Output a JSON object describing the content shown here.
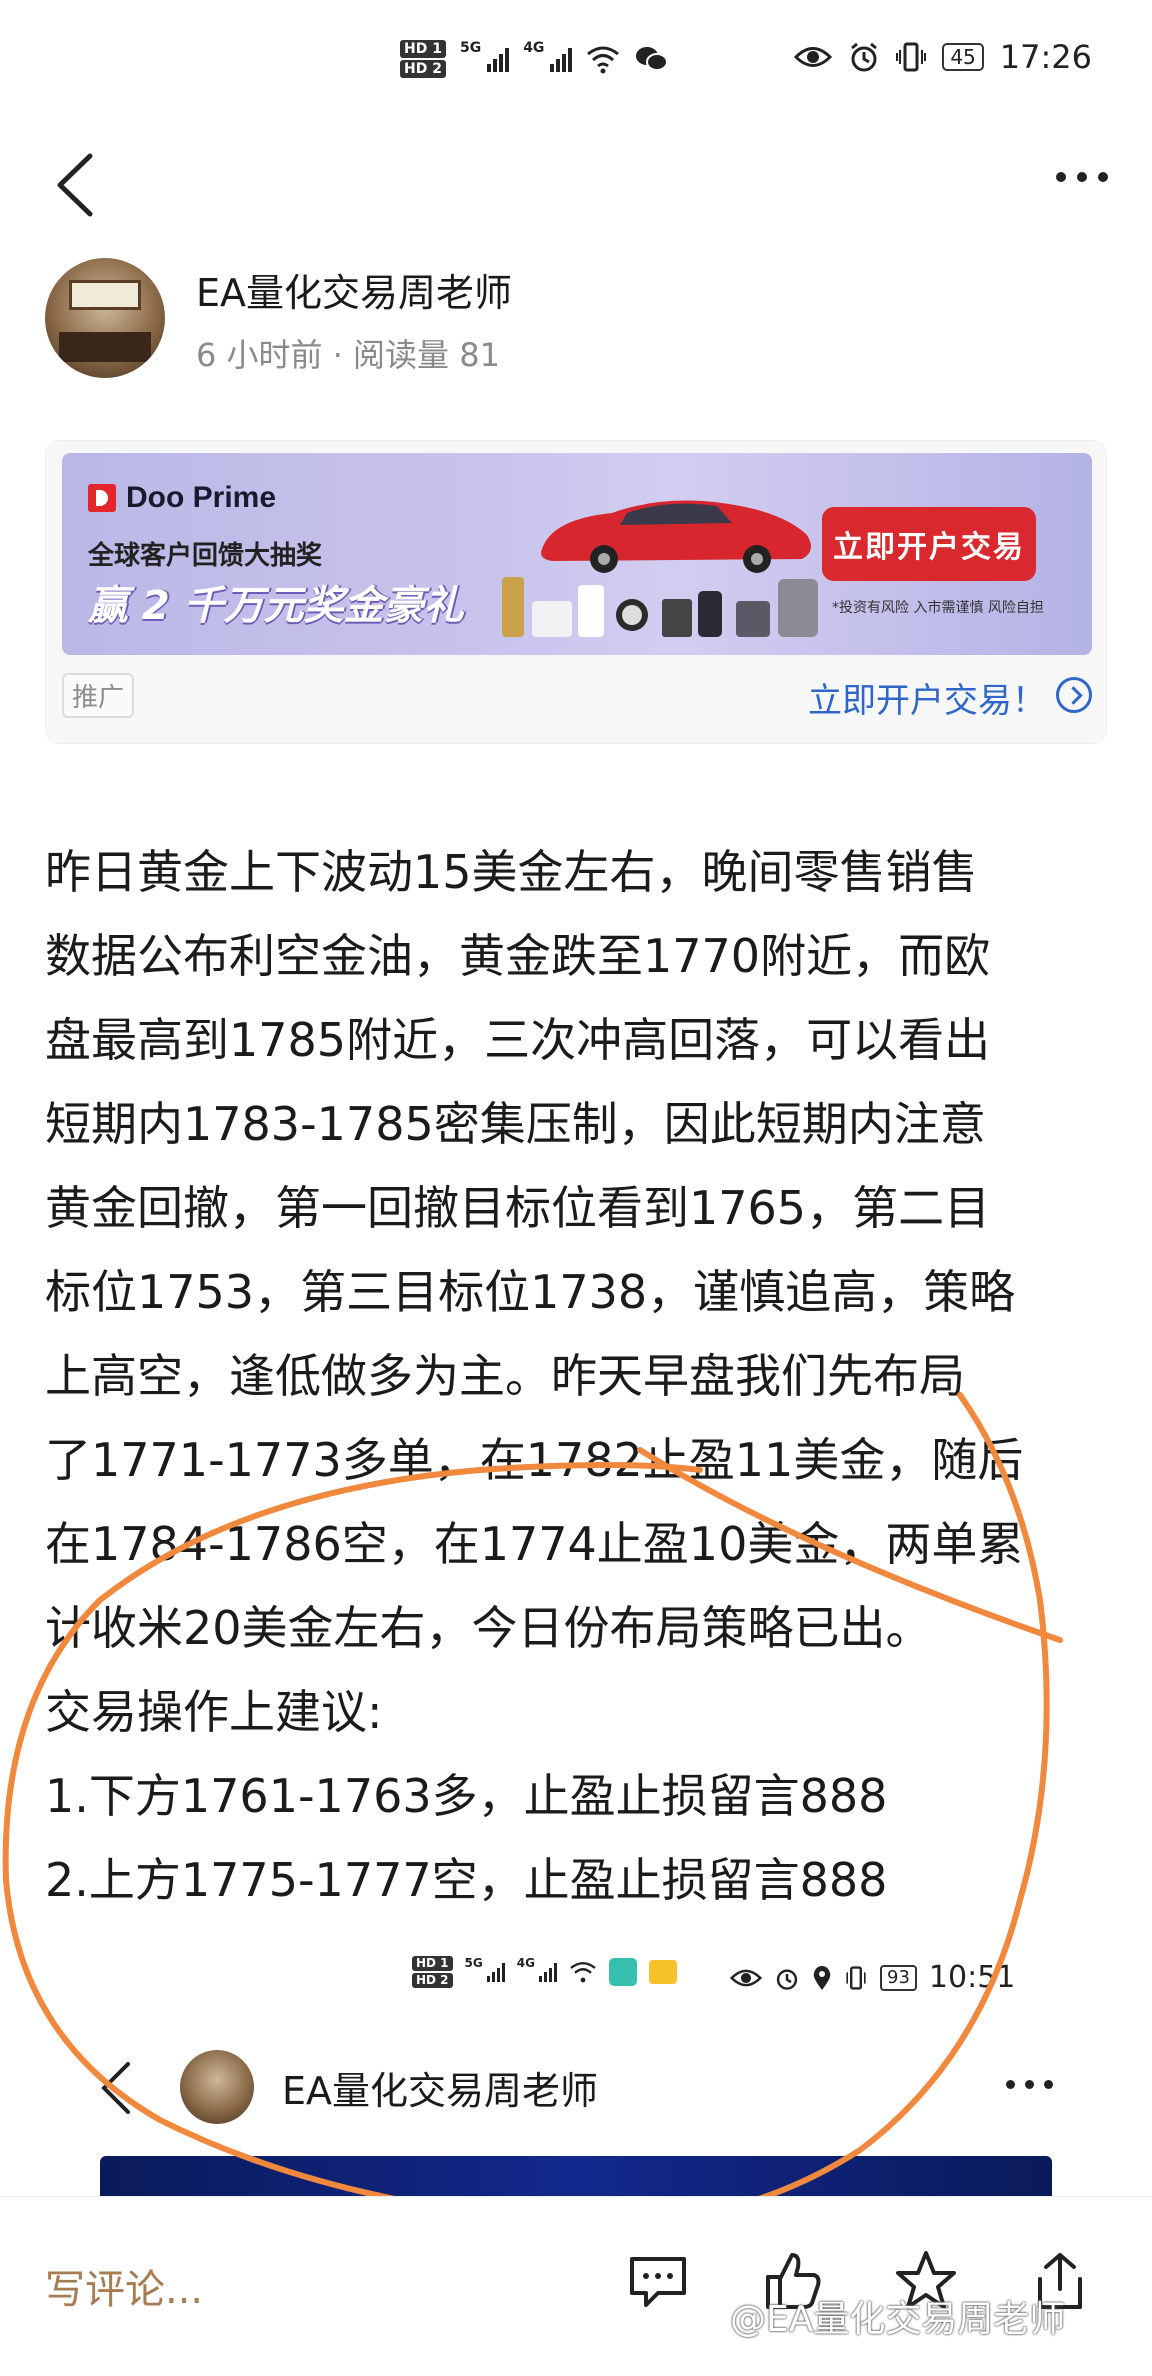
{
  "status_bar": {
    "hd1": "HD 1",
    "hd2": "HD 2",
    "net1": "5G",
    "net2": "4G",
    "wifi_tag": "6",
    "battery": "45",
    "time": "17:26"
  },
  "author": {
    "name": "EA量化交易周老师",
    "meta": "6 小时前 · 阅读量 81"
  },
  "ad": {
    "brand": "Doo Prime",
    "line1": "全球客户回馈大抽奖",
    "line2": "赢 2 千万元奖金豪礼",
    "cta": "立即开户交易",
    "disclaimer": "*投资有风险 入市需谨慎 风险自担",
    "tag": "推广",
    "link": "立即开户交易！"
  },
  "article": {
    "lines": [
      "昨日黄金上下波动15美金左右，晚间零售销售",
      "数据公布利空金油，黄金跌至1770附近，而欧",
      "盘最高到1785附近，三次冲高回落，可以看出",
      "短期内1783-1785密集压制，因此短期内注意",
      "黄金回撤，第一回撤目标位看到1765，第二目",
      "标位1753，第三目标位1738，谨慎追高，策略",
      "上高空，逢低做多为主。昨天早盘我们先布局",
      "了1771-1773多单，在1782止盈11美金，随后",
      "在1784-1786空，在1774止盈10美金，两单累",
      "计收米20美金左右，今日份布局策略已出。",
      "交易操作上建议:",
      "1.下方1761-1763多，止盈止损留言888",
      "2.上方1775-1777空，止盈止损留言888"
    ]
  },
  "embedded": {
    "battery": "93",
    "time": "10:51",
    "author_name": "EA量化交易周老师"
  },
  "bottom_bar": {
    "comment_placeholder": "写评论...",
    "watermark": "@EA量化交易周老师"
  },
  "colors": {
    "annotation": "#f0883e",
    "link": "#2f66c9",
    "cta_red": "#d9282e",
    "comment_brown": "#a67c52"
  }
}
